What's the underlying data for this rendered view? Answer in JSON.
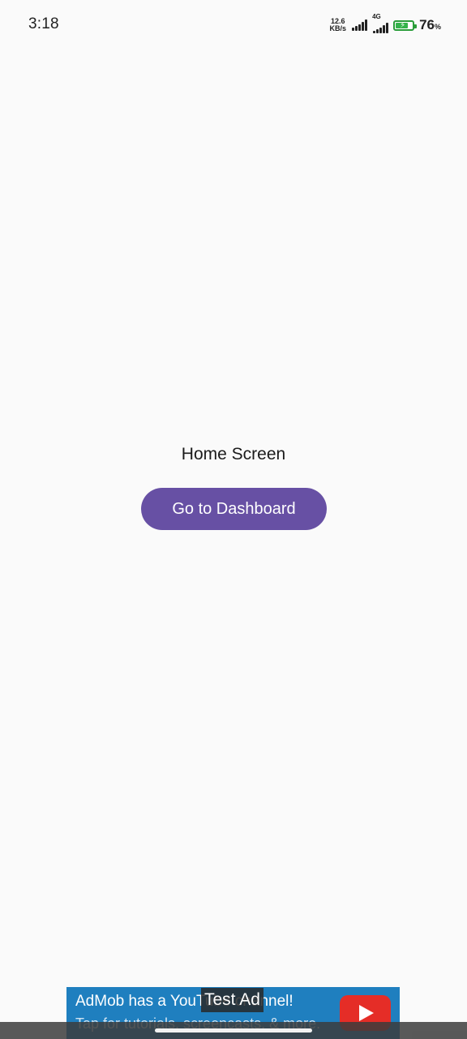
{
  "status_bar": {
    "time": "3:18",
    "net_speed_value": "12.6",
    "net_speed_unit": "KB/s",
    "network_type": "4G",
    "battery_percent": "76",
    "battery_unit": "%",
    "battery_level": 0.76,
    "battery_color": "#34b34a"
  },
  "main": {
    "title": "Home Screen",
    "dashboard_button_label": "Go to Dashboard",
    "button_color": "#6750a4"
  },
  "ad": {
    "line1": "AdMob has a YouTube channel!",
    "line2": "Tap for tutorials, screencasts, & more.",
    "test_label": "Test Ad",
    "banner_color": "#1f7fbf",
    "play_icon": "youtube-play-icon"
  }
}
